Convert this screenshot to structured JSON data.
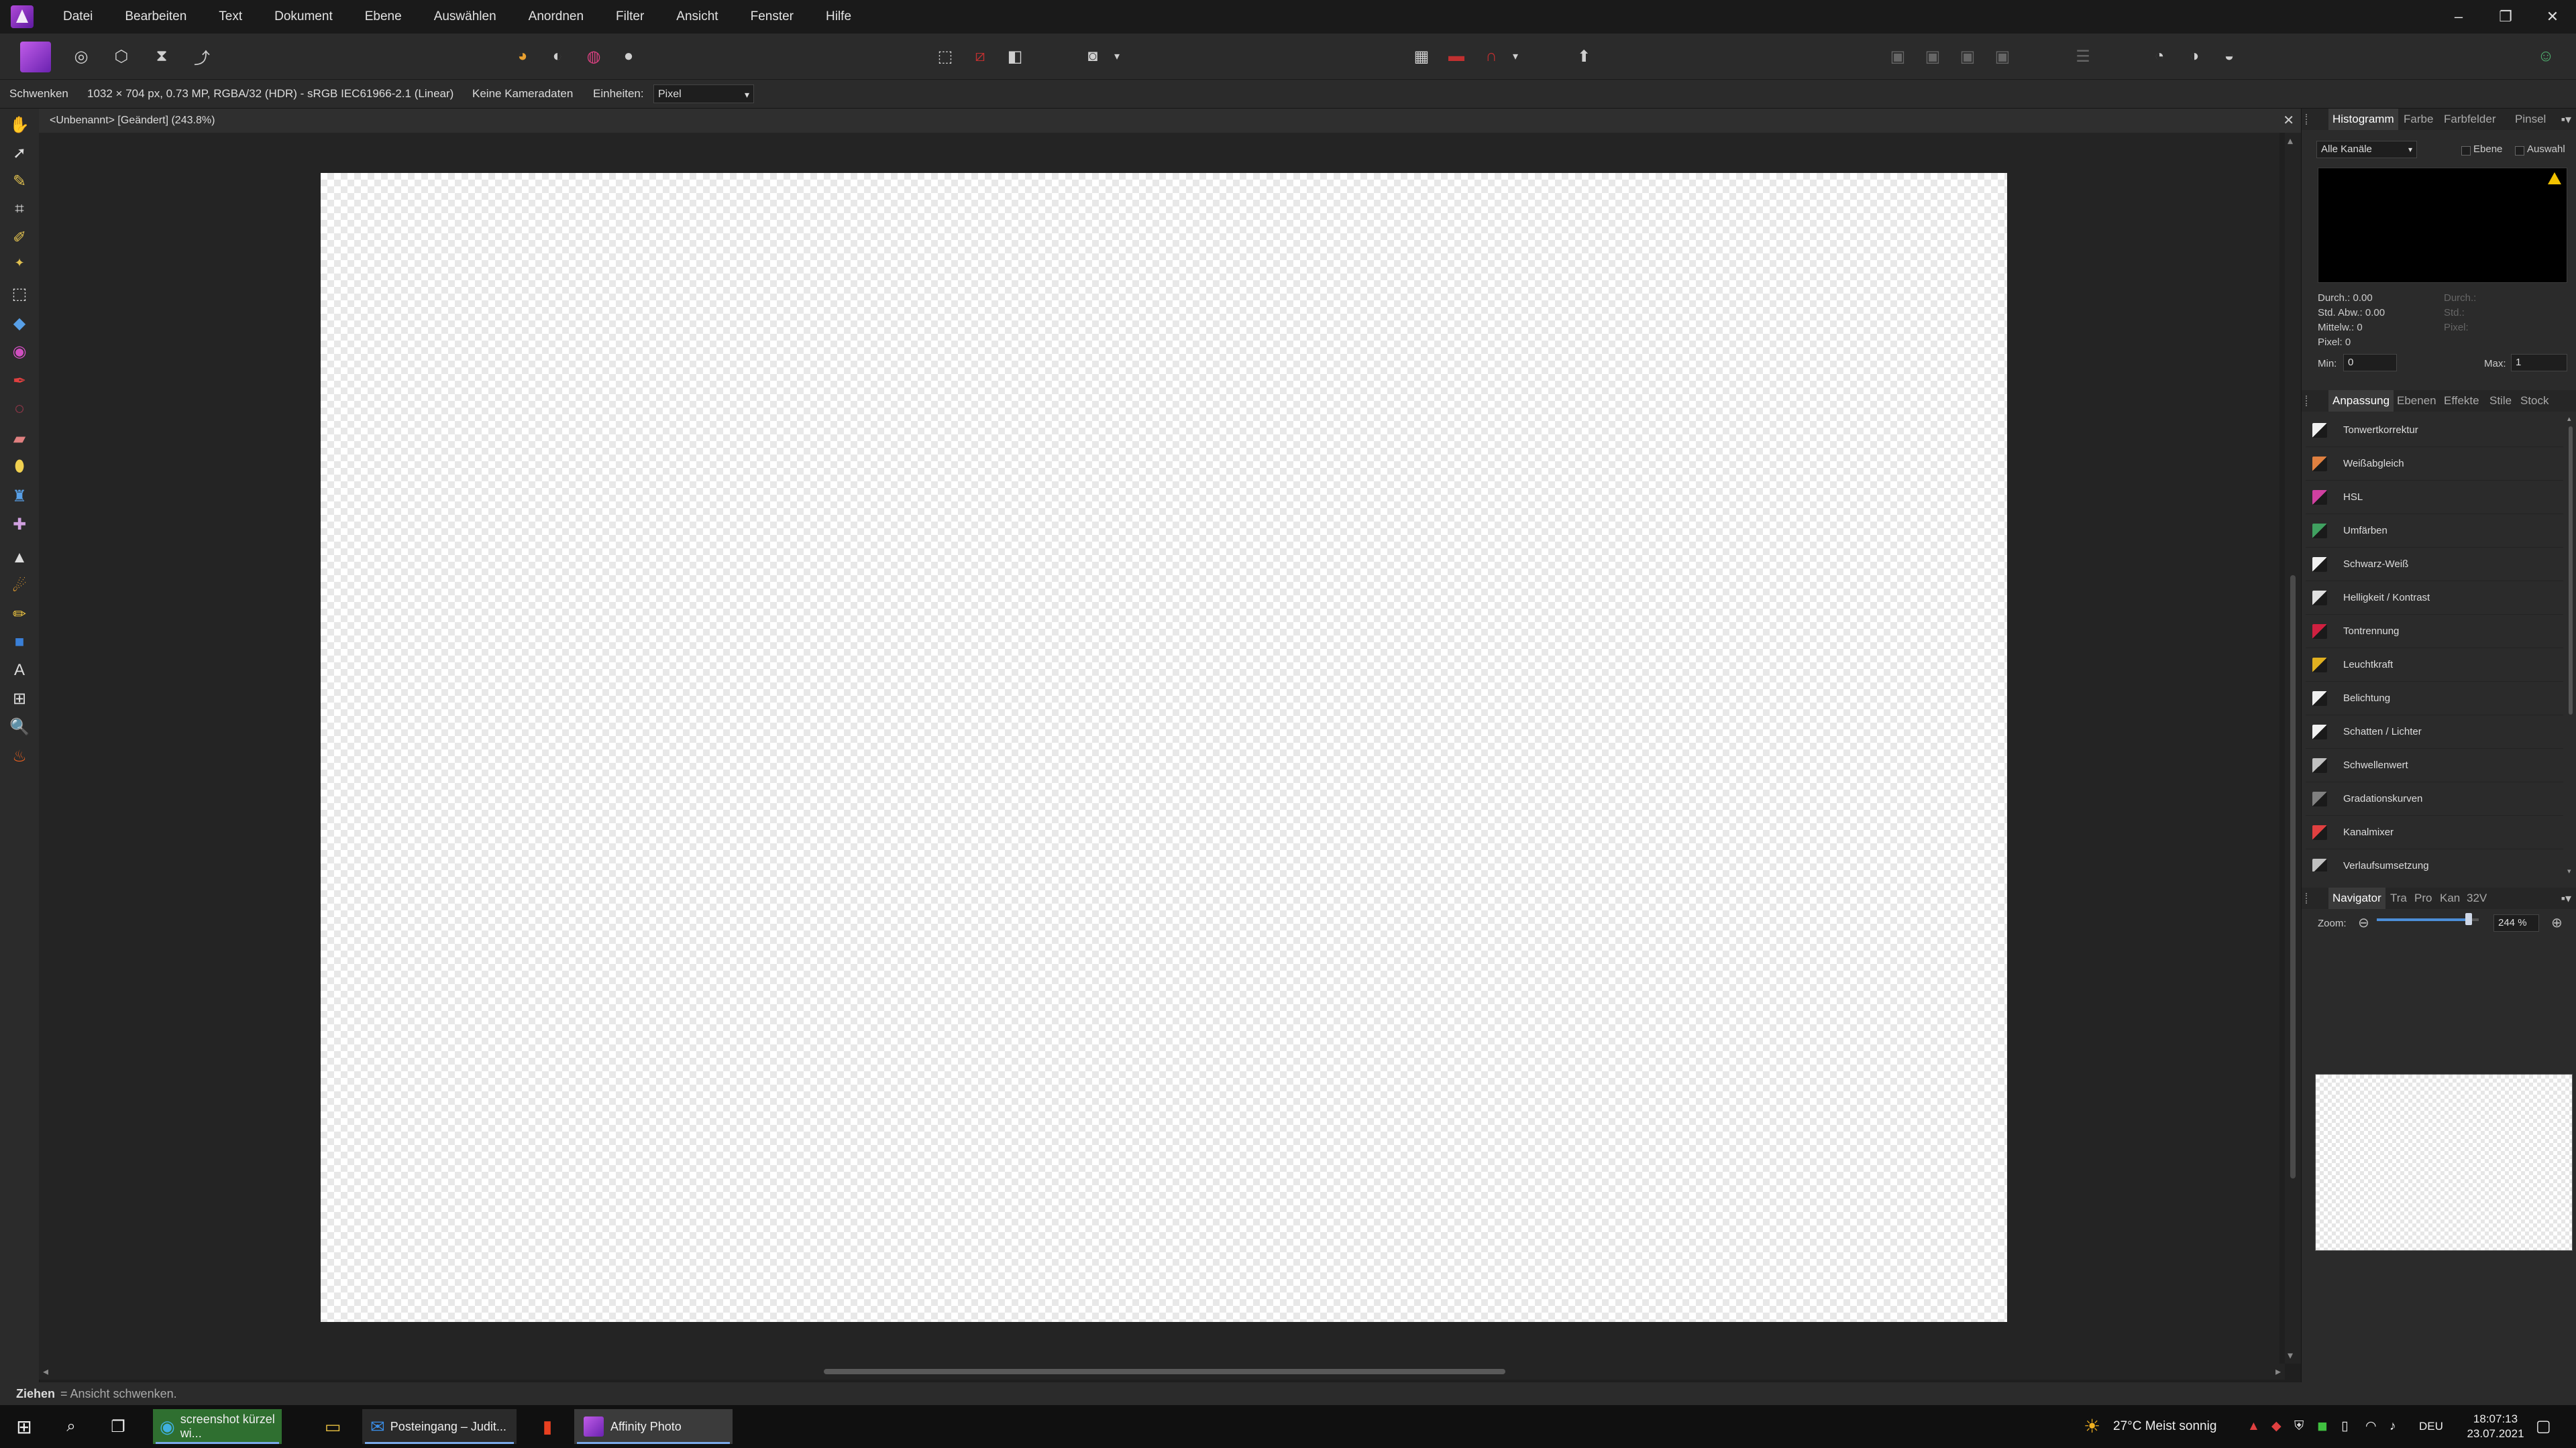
{
  "menu": [
    "Datei",
    "Bearbeiten",
    "Text",
    "Dokument",
    "Ebene",
    "Auswählen",
    "Anordnen",
    "Filter",
    "Ansicht",
    "Fenster",
    "Hilfe"
  ],
  "window_controls": {
    "minimize": "–",
    "restore": "❐",
    "close": "✕"
  },
  "context": {
    "tool_name": "Schwenken",
    "doc_info": "1032 × 704 px, 0.73 MP, RGBA/32 (HDR) - sRGB IEC61966-2.1 (Linear)",
    "camera": "Keine Kameradaten",
    "units_label": "Einheiten:",
    "units_value": "Pixel"
  },
  "document": {
    "title": "<Unbenannt> [Geändert] (243.8%)",
    "close": "✕"
  },
  "histogram_panel": {
    "tabs": [
      "Histogramm",
      "Farbe",
      "Farbfelder",
      "Pinsel"
    ],
    "channel": "Alle Kanäle",
    "layer_label": "Ebene",
    "selection_label": "Auswahl",
    "stats": [
      "Durch.: 0.00",
      "Std. Abw.: 0.00",
      "Mittelw.: 0",
      "Pixel: 0"
    ],
    "stats_right": [
      "Durch.:",
      "Std.:",
      "Pixel:"
    ],
    "min_label": "Min:",
    "min_value": "0",
    "max_label": "Max:",
    "max_value": "1"
  },
  "adjustment_panel": {
    "tabs": [
      "Anpassung",
      "Ebenen",
      "Effekte",
      "Stile",
      "Stock"
    ],
    "items": [
      "Tonwertkorrektur",
      "Weißabgleich",
      "HSL",
      "Umfärben",
      "Schwarz-Weiß",
      "Helligkeit / Kontrast",
      "Tontrennung",
      "Leuchtkraft",
      "Belichtung",
      "Schatten / Lichter",
      "Schwellenwert",
      "Gradationskurven",
      "Kanalmixer",
      "Verlaufsumsetzung"
    ],
    "icon_colors": [
      "#f0f0f0",
      "#e08040",
      "#d040a0",
      "#40a060",
      "#f0f0f0",
      "#e0e0e0",
      "#d02040",
      "#e0b020",
      "#f0f0f0",
      "#f0f0f0",
      "#c0c0c0",
      "#808080",
      "#e04040",
      "#c0c0c0"
    ]
  },
  "navigator_panel": {
    "tabs": [
      "Navigator",
      "Tra",
      "Pro",
      "Kan",
      "32V"
    ],
    "zoom_label": "Zoom:",
    "zoom_value": "244 %",
    "zoom_fraction": 0.9
  },
  "status": {
    "bold": "Ziehen",
    "text": "= Ansicht schwenken."
  },
  "taskbar": {
    "apps": [
      "screenshot kürzel wi...",
      "Posteingang – Judit...",
      "Affinity Photo"
    ],
    "weather": "27°C  Meist sonnig",
    "lang": "DEU",
    "time": "18:07:13",
    "date": "23.07.2021"
  }
}
